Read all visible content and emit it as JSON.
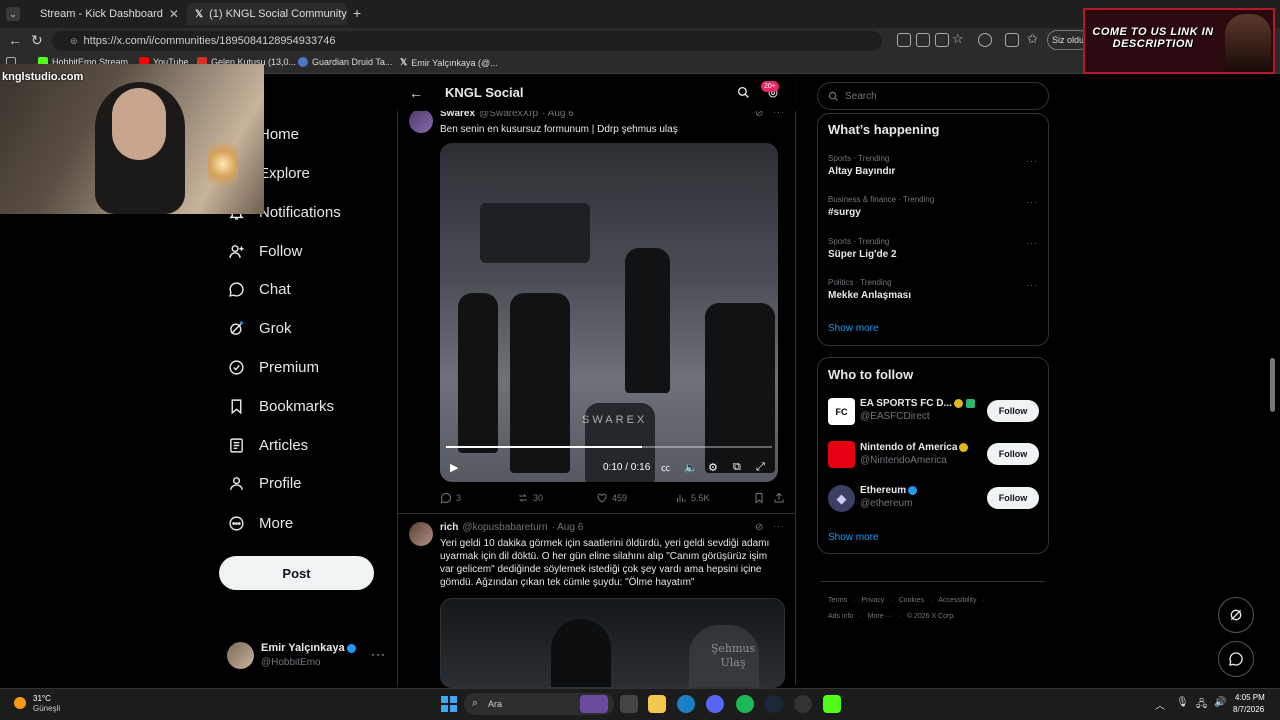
{
  "browser": {
    "tabs": [
      {
        "title": "Stream - Kick Dashboard",
        "active": false
      },
      {
        "title": "(1) KNGL Social Community / X",
        "active": true
      }
    ],
    "new_tab": "+",
    "url": "https://x.com/i/communities/1895084128954933746",
    "profile_button": "Siz oldu",
    "bookmarks": [
      "HobbitEmo Stream",
      "YouTube",
      "Gelen Kutusu (13,0...",
      "Guardian Druid Ta...",
      "Emir Yalçınkaya (@..."
    ]
  },
  "overlays": {
    "webcam_label": "knglstudio.com",
    "promo_text": "COME TO US LINK IN DESCRIPTION"
  },
  "sidebar": {
    "items": [
      {
        "label": "Home",
        "icon": "home-icon"
      },
      {
        "label": "Explore",
        "icon": "search-icon"
      },
      {
        "label": "Notifications",
        "icon": "bell-icon"
      },
      {
        "label": "Follow",
        "icon": "add-user-icon"
      },
      {
        "label": "Chat",
        "icon": "chat-icon"
      },
      {
        "label": "Grok",
        "icon": "grok-icon"
      },
      {
        "label": "Premium",
        "icon": "verified-icon"
      },
      {
        "label": "Bookmarks",
        "icon": "bookmark-icon"
      },
      {
        "label": "Articles",
        "icon": "article-icon"
      },
      {
        "label": "Profile",
        "icon": "person-icon"
      },
      {
        "label": "More",
        "icon": "more-circle-icon"
      }
    ],
    "post_button": "Post",
    "account": {
      "name": "Emir Yalçınkaya",
      "handle": "@HobbitEmo",
      "more": "···"
    }
  },
  "main": {
    "title": "KNGL Social",
    "notification_badge": "20+",
    "tweets": [
      {
        "name": "Swarex",
        "handle": "@SwarexXrp",
        "date": "· Aug 6",
        "text": "Ben senin en kusursuz formunum | Ddrp şehmus ulaş",
        "video": {
          "watermark": "SWAREX",
          "time": "0:10 / 0:16",
          "progress": 0.6
        },
        "stats": {
          "replies": "3",
          "reposts": "30",
          "likes": "459",
          "views": "5.5K"
        }
      },
      {
        "name": "rich",
        "handle": "@kopusbabareturn",
        "date": "· Aug 6",
        "text": "Yeri geldi 10 dakika görmek için saatlerini öldürdü, yeri geldi sevdiği adamı uyarmak için dil döktü. O her gün eline silahını alıp \"Canım görüşürüz işim var gelicem\" dediğinde söylemek istediği çok şey vardı ama hepsini içine gömdü. Ağzından çıkan tek cümle şuydu: \"Ölme hayatım\"",
        "image_text": "Şehmus Ulaş"
      }
    ]
  },
  "right": {
    "search_placeholder": "Search",
    "happening": {
      "title": "What’s happening",
      "trends": [
        {
          "meta": "Sports · Trending",
          "name": "Altay Bayındır"
        },
        {
          "meta": "Business & finance · Trending",
          "name": "#surgy"
        },
        {
          "meta": "Sports · Trending",
          "name": "Süper Lig'de 2"
        },
        {
          "meta": "Politics · Trending",
          "name": "Mekke Anlaşması"
        }
      ],
      "show_more": "Show more"
    },
    "who_to_follow": {
      "title": "Who to follow",
      "accounts": [
        {
          "name": "EA SPORTS FC D...",
          "handle": "@EASFCDirect",
          "button": "Follow"
        },
        {
          "name": "Nintendo of America",
          "handle": "@NintendoAmerica",
          "button": "Follow"
        },
        {
          "name": "Ethereum",
          "handle": "@ethereum",
          "button": "Follow"
        }
      ],
      "show_more": "Show more"
    },
    "footer": {
      "line1": [
        "Terms",
        "·",
        "Privacy",
        "·",
        "Cookies",
        "·",
        "Accessibility",
        "·"
      ],
      "line2": [
        "Ads info",
        "·",
        "More ···",
        "·",
        "© 2026 X Corp."
      ]
    }
  },
  "taskbar": {
    "temperature": "31°C",
    "weather": "Güneşli",
    "search_placeholder": "Ara",
    "time": "4:05 PM",
    "date": "8/7/2026"
  },
  "colors": {
    "accent": "#1d9bf0",
    "background": "#000000",
    "border": "#2f3336",
    "badge": "#e2286b"
  }
}
